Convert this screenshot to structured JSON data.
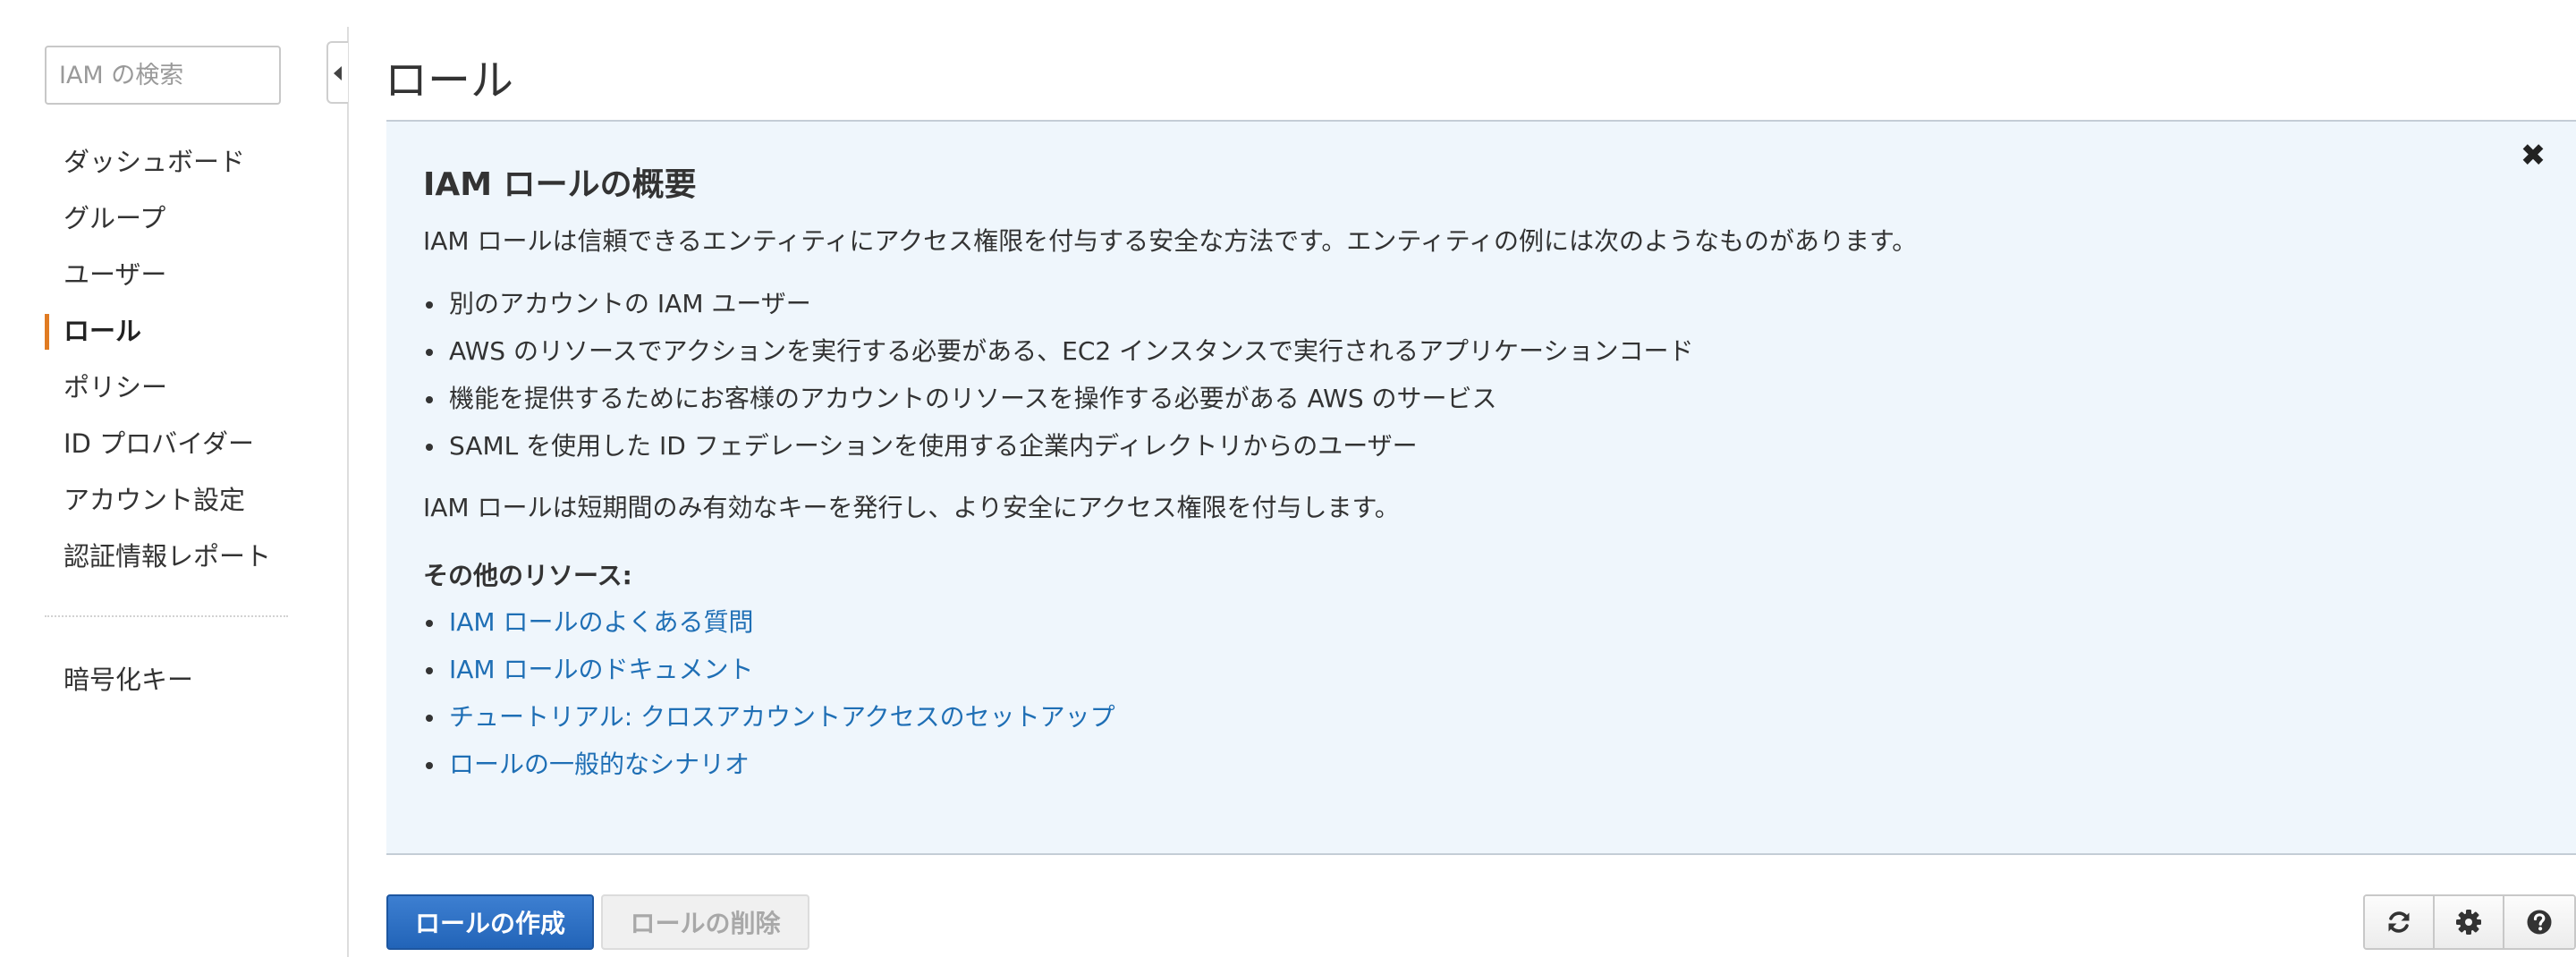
{
  "sidebar": {
    "search_placeholder": "IAM の検索",
    "items": [
      {
        "label": "ダッシュボード"
      },
      {
        "label": "グループ"
      },
      {
        "label": "ユーザー"
      },
      {
        "label": "ロール",
        "active": true
      },
      {
        "label": "ポリシー"
      },
      {
        "label": "ID プロバイダー"
      },
      {
        "label": "アカウント設定"
      },
      {
        "label": "認証情報レポート"
      }
    ],
    "secondary_items": [
      {
        "label": "暗号化キー"
      }
    ]
  },
  "main": {
    "title": "ロール",
    "info_panel": {
      "heading": "IAM ロールの概要",
      "intro": "IAM ロールは信頼できるエンティティにアクセス権限を付与する安全な方法です。エンティティの例には次のようなものがあります。",
      "examples": [
        "別のアカウントの IAM ユーザー",
        "AWS のリソースでアクションを実行する必要がある、EC2 インスタンスで実行されるアプリケーションコード",
        "機能を提供するためにお客様のアカウントのリソースを操作する必要がある AWS のサービス",
        "SAML を使用した ID フェデレーションを使用する企業内ディレクトリからのユーザー"
      ],
      "summary": "IAM ロールは短期間のみ有効なキーを発行し、より安全にアクセス権限を付与します。",
      "resources_heading": "その他のリソース:",
      "resource_links": [
        "IAM ロールのよくある質問",
        "IAM ロールのドキュメント",
        "チュートリアル: クロスアカウントアクセスのセットアップ",
        "ロールの一般的なシナリオ"
      ],
      "close_icon": "close-icon"
    },
    "toolbar": {
      "create_label": "ロールの作成",
      "delete_label": "ロールの削除",
      "icons": [
        "refresh-icon",
        "gear-icon",
        "help-icon"
      ]
    }
  },
  "colors": {
    "accent": "#e07b22",
    "primary_button": "#2264b8",
    "link": "#1f6fb5",
    "info_panel_bg": "#eff6fc"
  }
}
